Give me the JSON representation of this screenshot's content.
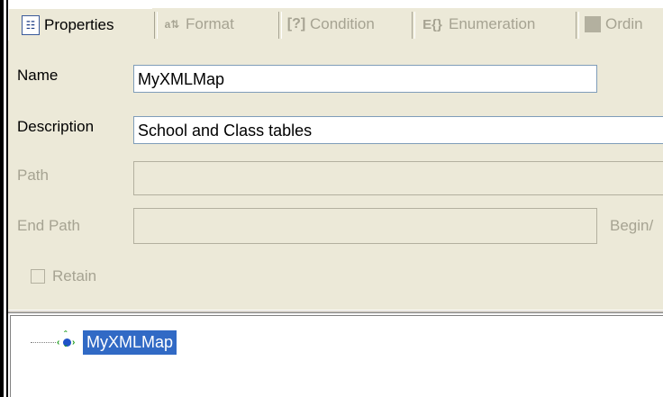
{
  "tabs": [
    {
      "label": "Properties",
      "icon": "properties-icon",
      "active": true
    },
    {
      "label": "Format",
      "icon": "format-icon",
      "active": false
    },
    {
      "label": "Condition",
      "icon": "condition-icon",
      "active": false
    },
    {
      "label": "Enumeration",
      "icon": "enumeration-icon",
      "active": false
    },
    {
      "label": "Ordin",
      "icon": "ordinal-icon",
      "active": false
    }
  ],
  "form": {
    "name_label": "Name",
    "name_value": "MyXMLMap",
    "description_label": "Description",
    "description_value": "School and Class tables",
    "path_label": "Path",
    "path_value": "",
    "end_path_label": "End Path",
    "end_path_value": "",
    "begin_label": "Begin/",
    "retain_label": "Retain",
    "retain_checked": false
  },
  "tree": {
    "root_label": "MyXMLMap"
  },
  "colors": {
    "panel_bg": "#ece9d8",
    "selection": "#316ac5",
    "disabled_text": "#a6a392"
  }
}
